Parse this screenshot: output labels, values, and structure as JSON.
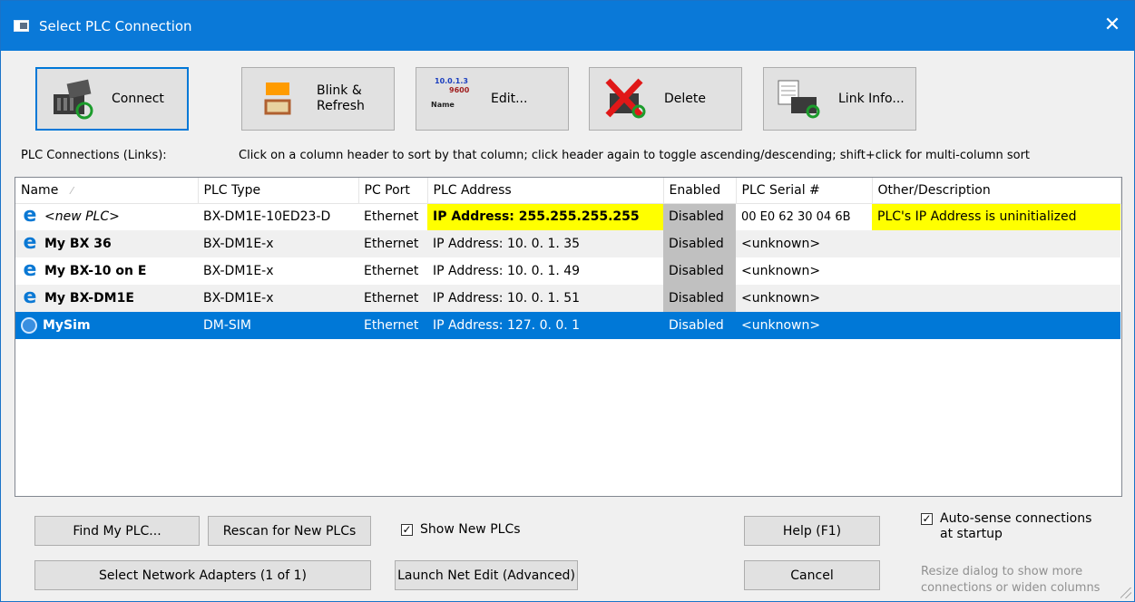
{
  "window": {
    "title": "Select PLC Connection",
    "close_glyph": "✕"
  },
  "toolbar": {
    "connect": "Connect",
    "blink_refresh": [
      "Blink &",
      "Refresh"
    ],
    "edit": "Edit...",
    "edit_icon_text": [
      "10.0.1.3",
      "9600",
      "Name"
    ],
    "delete": "Delete",
    "link_info": "Link Info..."
  },
  "list": {
    "label": "PLC Connections (Links):",
    "hint": "Click on a column header to sort by that column; click header again to toggle ascending/descending; shift+click for multi-column sort",
    "columns": [
      "Name",
      "PLC Type",
      "PC Port",
      "PLC Address",
      "Enabled",
      "PLC Serial #",
      "Other/Description"
    ],
    "rows": [
      {
        "name": "<new PLC>",
        "type": "BX-DM1E-10ED23-D",
        "port": "Ethernet",
        "address": "IP Address: 255.255.255.255",
        "enabled": "Disabled",
        "serial": "00 E0 62 30 04 6B",
        "desc": "PLC's IP Address is uninitialized",
        "icon": "ethernet-e-icon"
      },
      {
        "name": "My BX 36",
        "type": "BX-DM1E-x",
        "port": "Ethernet",
        "address": "IP Address:  10.  0.  1. 35",
        "enabled": "Disabled",
        "serial": "<unknown>",
        "desc": "",
        "icon": "ethernet-e-icon"
      },
      {
        "name": "My BX-10 on E",
        "type": "BX-DM1E-x",
        "port": "Ethernet",
        "address": "IP Address:  10.  0.  1. 49",
        "enabled": "Disabled",
        "serial": "<unknown>",
        "desc": "",
        "icon": "ethernet-e-icon"
      },
      {
        "name": "My BX-DM1E",
        "type": "BX-DM1E-x",
        "port": "Ethernet",
        "address": "IP Address:  10.  0.  1. 51",
        "enabled": "Disabled",
        "serial": "<unknown>",
        "desc": "",
        "icon": "ethernet-e-icon"
      },
      {
        "name": "MySim",
        "type": "DM-SIM",
        "port": "Ethernet",
        "address": "IP Address: 127.  0.  0.  1",
        "enabled": "Disabled",
        "serial": "<unknown>",
        "desc": "",
        "icon": "simulator-icon"
      }
    ]
  },
  "bottom": {
    "find_plc": "Find My PLC...",
    "rescan": "Rescan for New PLCs",
    "show_new": "Show New PLCs",
    "show_new_checked": true,
    "help": "Help (F1)",
    "auto_sense": [
      "Auto-sense connections",
      "at startup"
    ],
    "auto_sense_checked": true,
    "select_adapters": "Select Network Adapters (1 of 1)",
    "launch_netedit": "Launch Net Edit (Advanced)",
    "cancel": "Cancel",
    "resize_hint": [
      "Resize dialog to show more",
      "connections or widen columns"
    ]
  },
  "colors": {
    "accent": "#0078d7",
    "titlebar": "#0a79d8",
    "highlight": "#ffff00",
    "disabled_cell": "#c0c0c0"
  }
}
